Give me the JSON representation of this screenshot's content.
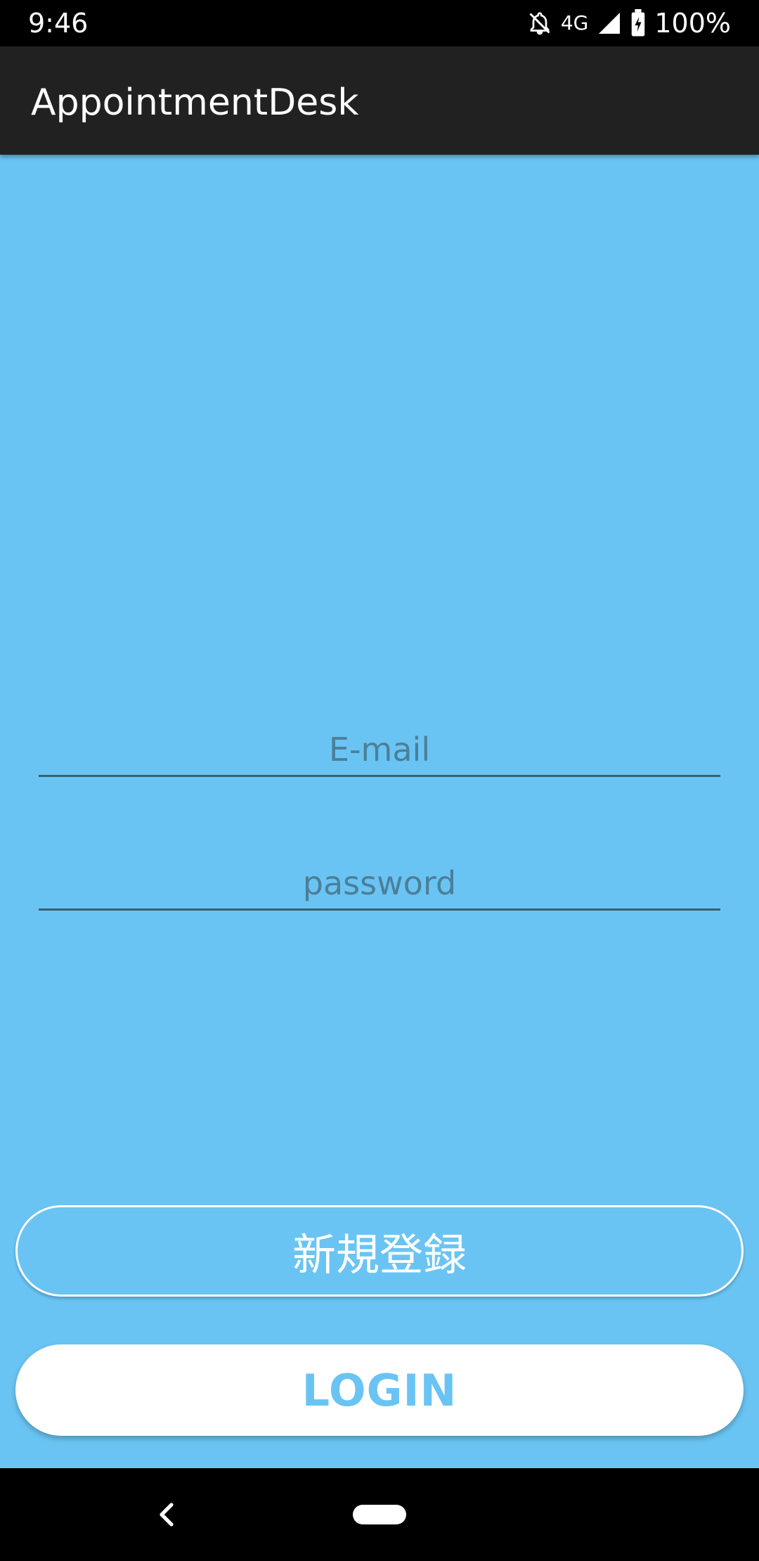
{
  "status_bar": {
    "time": "9:46",
    "network": "4G",
    "battery": "100%",
    "icons": [
      "notifications-off-icon",
      "signal-icon",
      "battery-charging-icon"
    ]
  },
  "app_bar": {
    "title": "AppointmentDesk"
  },
  "login_form": {
    "email_placeholder": "E-mail",
    "password_placeholder": "password"
  },
  "buttons": {
    "register_label": "新規登録",
    "login_label": "LOGIN"
  },
  "colors": {
    "background": "#6ac4f3",
    "app_bar": "#212121",
    "button_white": "#ffffff"
  },
  "nav_bar": {
    "icons": [
      "back-icon",
      "home-pill-icon"
    ]
  }
}
